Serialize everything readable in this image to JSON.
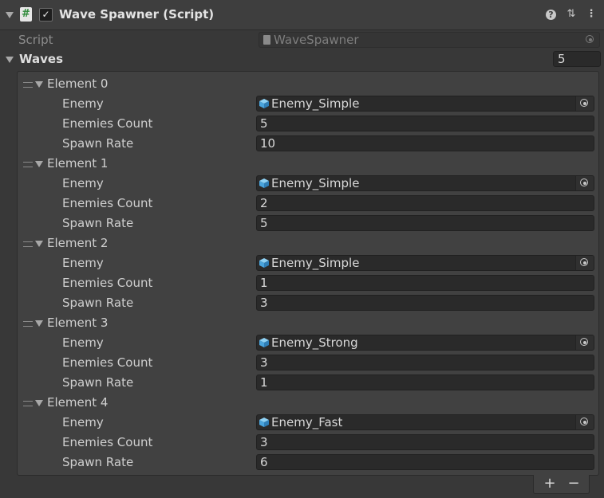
{
  "component": {
    "title": "Wave Spawner (Script)",
    "enabled_check": "✓",
    "script_label": "Script",
    "script_value": "WaveSpawner"
  },
  "waves": {
    "label": "Waves",
    "size": "5",
    "elements": [
      {
        "name": "Element 0",
        "enemy": "Enemy_Simple",
        "enemies_count": "5",
        "spawn_rate": "10"
      },
      {
        "name": "Element 1",
        "enemy": "Enemy_Simple",
        "enemies_count": "2",
        "spawn_rate": "5"
      },
      {
        "name": "Element 2",
        "enemy": "Enemy_Simple",
        "enemies_count": "1",
        "spawn_rate": "3"
      },
      {
        "name": "Element 3",
        "enemy": "Enemy_Strong",
        "enemies_count": "3",
        "spawn_rate": "1"
      },
      {
        "name": "Element 4",
        "enemy": "Enemy_Fast",
        "enemies_count": "3",
        "spawn_rate": "6"
      }
    ],
    "field_labels": {
      "enemy": "Enemy",
      "enemies_count": "Enemies Count",
      "spawn_rate": "Spawn Rate"
    }
  },
  "footer": {
    "add": "+",
    "remove": "−"
  },
  "icons": {
    "header_help": "help-icon",
    "header_presets": "presets-icon",
    "header_menu": "kebab-menu-icon",
    "prefab": "prefab-cube-icon",
    "picker": "object-picker-icon"
  },
  "colors": {
    "prefab_cube": "#5ab4e8",
    "script_hash": "#2f8a3a"
  }
}
